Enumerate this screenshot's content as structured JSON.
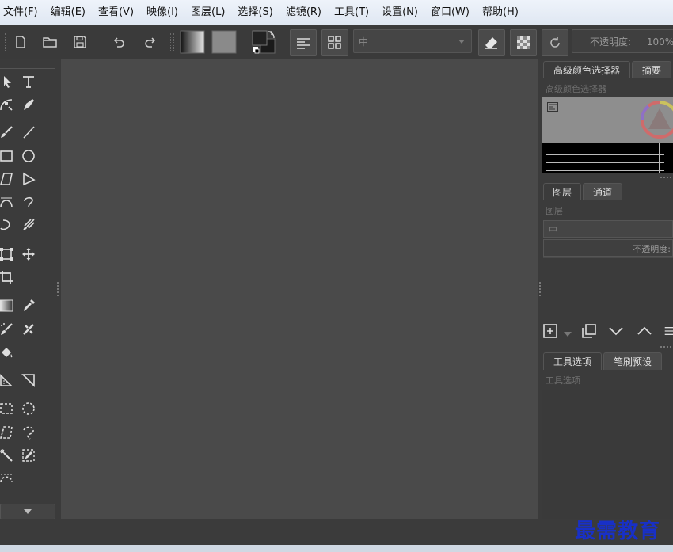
{
  "menu": [
    "文件(F)",
    "编辑(E)",
    "查看(V)",
    "映像(I)",
    "图层(L)",
    "选择(S)",
    "滤镜(R)",
    "工具(T)",
    "设置(N)",
    "窗口(W)",
    "帮助(H)"
  ],
  "toolbar": {
    "blend_mode": "中",
    "opacity_label": "不透明度:",
    "opacity_value": "100%"
  },
  "panels": {
    "color": {
      "tabs": [
        "高级颜色选择器",
        "摘要"
      ],
      "title": "高级颜色选择器"
    },
    "layers": {
      "tabs": [
        "图层",
        "通道"
      ],
      "title": "图层",
      "blend_mode": "中",
      "opacity_label": "不透明度:"
    },
    "tool_options": {
      "tabs": [
        "工具选项",
        "笔刷预设"
      ],
      "title": "工具选项"
    }
  },
  "watermark": "最需教育",
  "icons": {
    "toolbar": [
      "new-document-icon",
      "open-folder-icon",
      "save-icon",
      "undo-icon",
      "redo-icon",
      "gradient-icon",
      "pattern-icon",
      "foreground-background-colors-icon",
      "brush-settings-icon",
      "workspace-icon",
      "eraser-icon",
      "alpha-lock-icon",
      "reload-icon"
    ],
    "tools": [
      "select-icon",
      "text-icon",
      "edit-shapes-icon",
      "calligraphy-icon",
      "brush-icon",
      "line-icon",
      "rectangle-icon",
      "ellipse-icon",
      "polygon-icon",
      "polyline-icon",
      "bezier-icon",
      "freehand-path-icon",
      "dynamic-brush-icon",
      "multibrush-icon",
      "transform-icon",
      "move-icon",
      "crop-icon",
      "gradient-tool-icon",
      "color-picker-icon",
      "smart-patch-icon",
      "fill-icon",
      "assistant-icon",
      "measure-icon",
      "rect-select-icon",
      "ellipse-select-icon",
      "polygon-select-icon",
      "freehand-select-icon",
      "magic-wand-icon",
      "similar-select-icon",
      "bezier-select-icon"
    ]
  }
}
